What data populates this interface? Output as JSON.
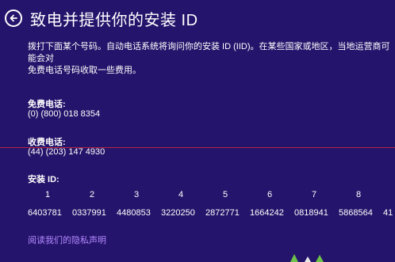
{
  "header": {
    "back_icon": "back-arrow-icon",
    "title": "致电并提供你的安装 ID"
  },
  "description": "拨打下面某个号码。自动电话系统将询问你的安装 ID (IID)。在某些国家或地区，当地运营商可能会对\n免费电话号码收取一些费用。",
  "toll_free": {
    "label": "免费电话:",
    "number": "(0) (800) 018 8354"
  },
  "toll": {
    "label": "收费电话:",
    "number": "(44) (203) 147 4930"
  },
  "installation_id": {
    "label": "安装 ID:",
    "columns": [
      "1",
      "2",
      "3",
      "4",
      "5",
      "6",
      "7",
      "8"
    ],
    "groups": [
      "6403781",
      "0337991",
      "4480853",
      "3220250",
      "2872771",
      "1664242",
      "0818941",
      "5868564",
      "41"
    ]
  },
  "privacy_link": "阅读我们的隐私声明",
  "colors": {
    "background": "#25146b",
    "divider": "#b3243f",
    "link": "#b289ff",
    "text": "#ffffff"
  }
}
